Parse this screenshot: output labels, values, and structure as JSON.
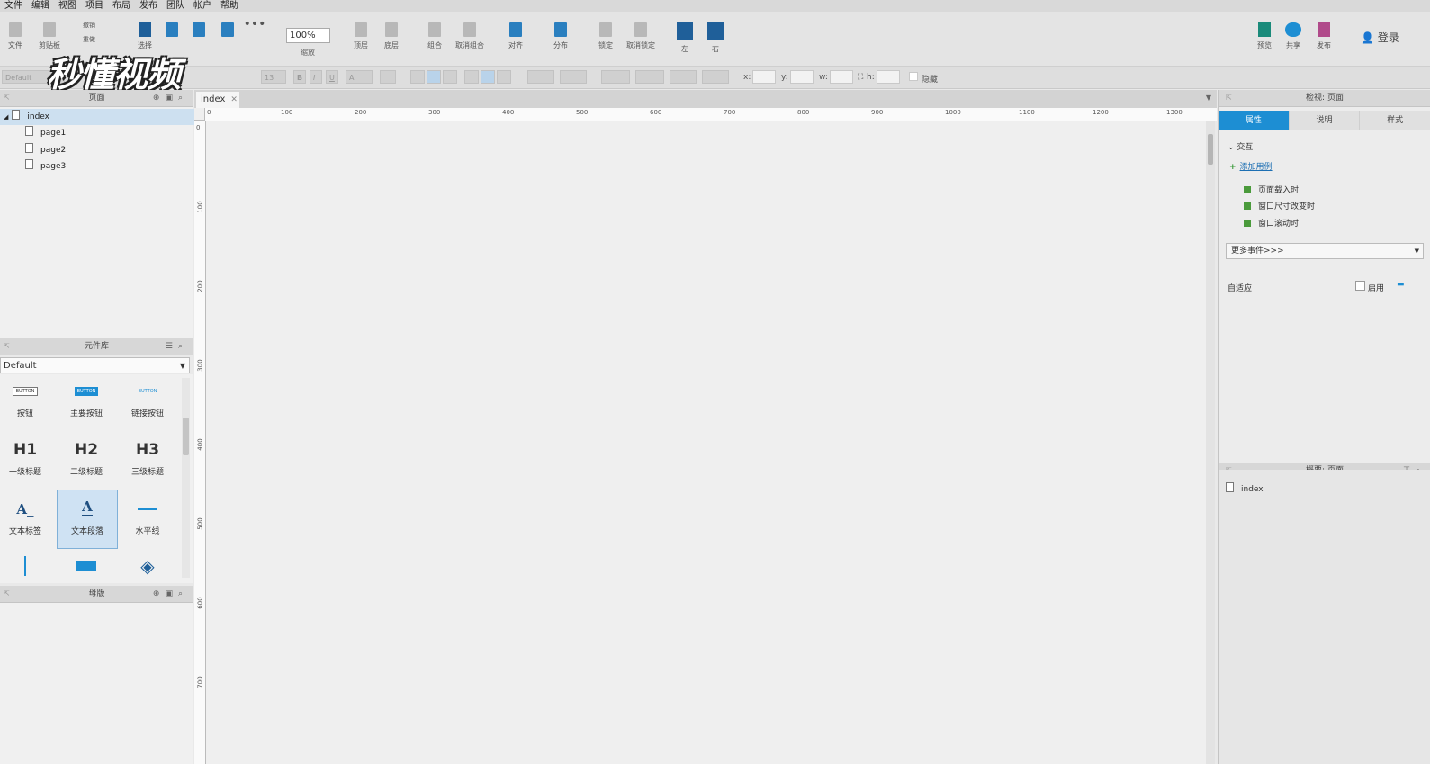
{
  "menu": [
    "文件",
    "编辑",
    "视图",
    "项目",
    "布局",
    "发布",
    "团队",
    "帐户",
    "帮助"
  ],
  "toolbar": {
    "file_label": "文件",
    "clipboard_label": "剪贴板",
    "undo_label": "撤销",
    "redo_label": "重做",
    "select_label": "选择",
    "zoom_value": "100%",
    "zoom_label": "缩放",
    "top_label": "顶层",
    "bottom_label": "底层",
    "group_label": "组合",
    "ungroup_label": "取消组合",
    "align_label": "对齐",
    "distribute_label": "分布",
    "lock_label": "锁定",
    "unlock_label": "取消锁定",
    "left_label": "左",
    "right_label": "右",
    "preview_label": "预览",
    "share_label": "共享",
    "publish_label": "发布",
    "login_label": "登录"
  },
  "formatbar": {
    "style_value": "Default",
    "font_size": "13",
    "x_label": "x:",
    "y_label": "y:",
    "w_label": "w:",
    "h_label": "h:",
    "hidden_label": "隐藏"
  },
  "watermark": "秒懂视频",
  "pages_panel": {
    "title": "页面",
    "items": [
      {
        "label": "index",
        "selected": true
      },
      {
        "label": "page1"
      },
      {
        "label": "page2"
      },
      {
        "label": "page3"
      }
    ]
  },
  "library_panel": {
    "title": "元件库",
    "selected_library": "Default",
    "widgets": [
      {
        "label": "按钮",
        "icon": "button-icon",
        "text": "BUTTON"
      },
      {
        "label": "主要按钮",
        "icon": "primary-button-icon",
        "text": "BUTTON"
      },
      {
        "label": "链接按钮",
        "icon": "link-button-icon",
        "text": "BUTTON"
      },
      {
        "label": "一级标题",
        "icon": "h1-icon",
        "text": "H1"
      },
      {
        "label": "二级标题",
        "icon": "h2-icon",
        "text": "H2"
      },
      {
        "label": "三级标题",
        "icon": "h3-icon",
        "text": "H3"
      },
      {
        "label": "文本标签",
        "icon": "text-label-icon",
        "text": "A_"
      },
      {
        "label": "文本段落",
        "icon": "text-paragraph-icon",
        "text": "A"
      },
      {
        "label": "水平线",
        "icon": "horizontal-line-icon",
        "text": ""
      }
    ]
  },
  "masters_panel": {
    "title": "母版"
  },
  "canvas": {
    "tab_label": "index",
    "ruler_h": [
      "0",
      "100",
      "200",
      "300",
      "400",
      "500",
      "600",
      "700",
      "800",
      "900",
      "1000",
      "1100",
      "1200",
      "1300"
    ],
    "ruler_v": [
      "0",
      "100",
      "200",
      "300",
      "400",
      "500",
      "600",
      "700"
    ]
  },
  "inspector": {
    "title": "检视: 页面",
    "tabs": [
      "属性",
      "说明",
      "样式"
    ],
    "section": "交互",
    "add_case": "添加用例",
    "events": [
      "页面载入时",
      "窗口尺寸改变时",
      "窗口滚动时"
    ],
    "more_events": "更多事件>>>",
    "adaptive_label": "自适应",
    "enable_label": "启用"
  },
  "outline": {
    "title": "概要: 页面",
    "item": "index"
  }
}
